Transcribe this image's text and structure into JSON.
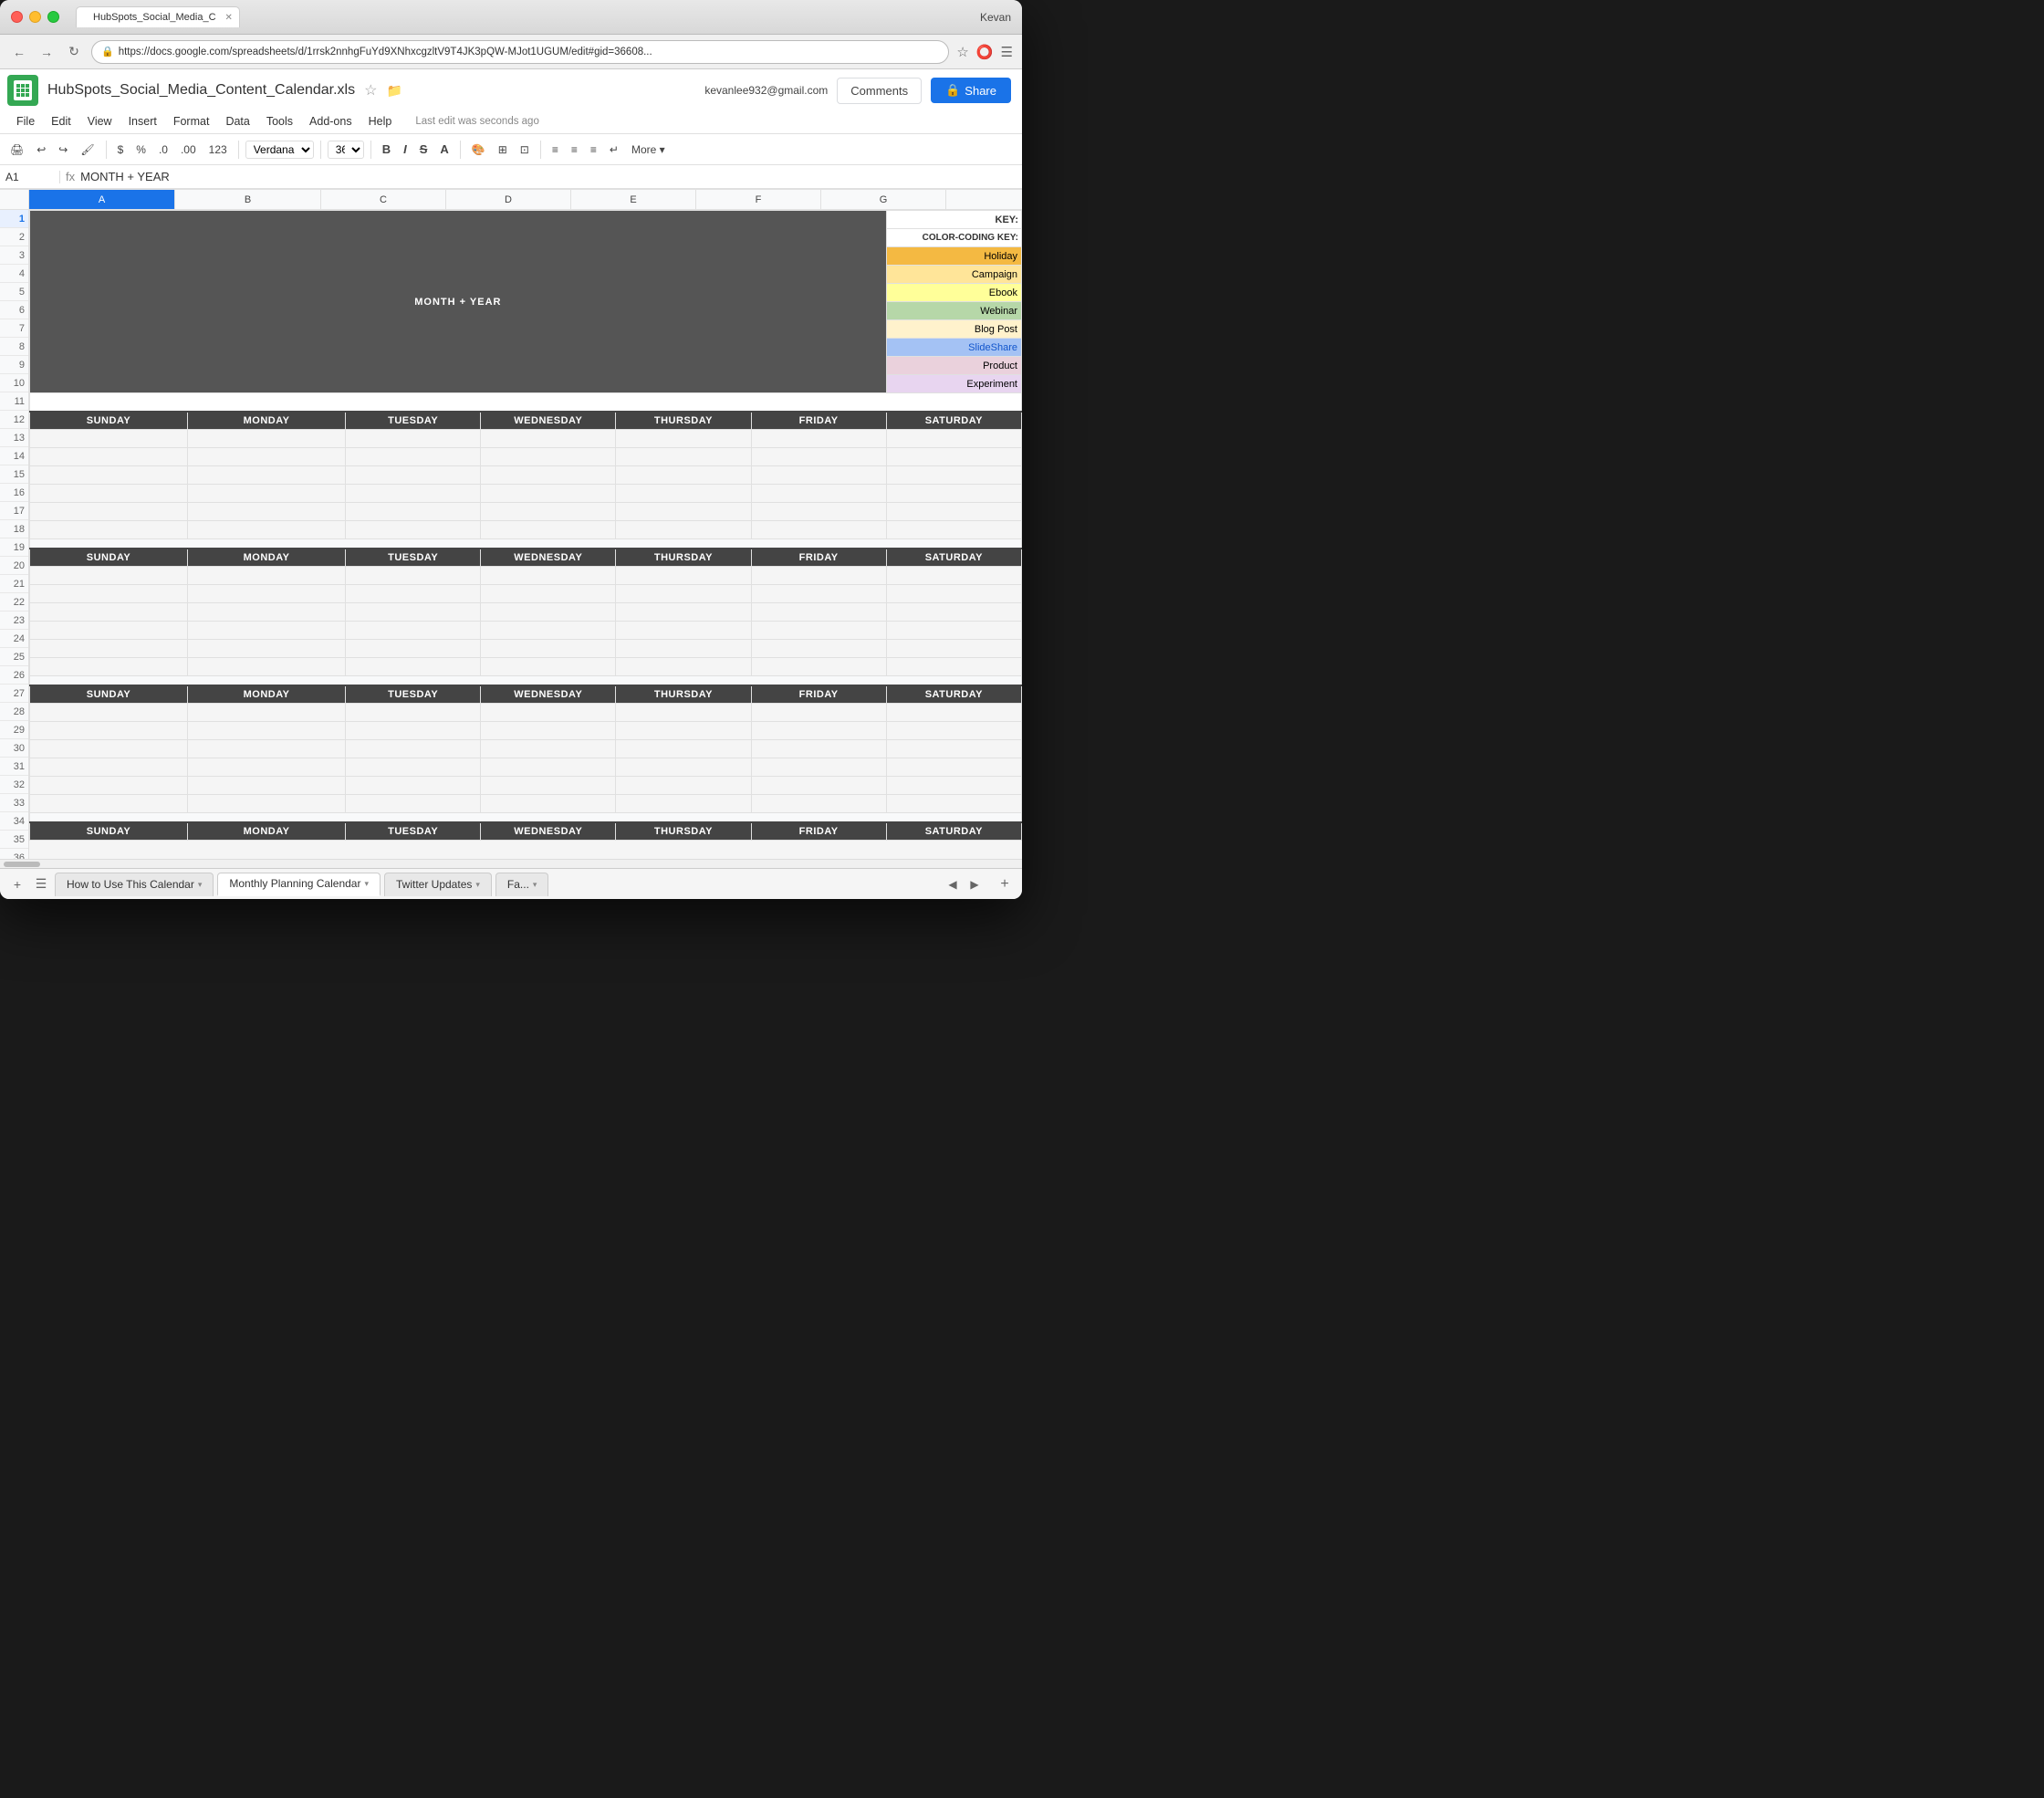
{
  "window": {
    "title": "HubSpots_Social_Media_C",
    "user": "Kevan",
    "url": "https://docs.google.com/spreadsheets/d/1rrsk2nnhgFuYd9XNhxcgzltV9T4JK3pQW-MJot1UGUM/edit#gid=36608...",
    "last_edit": "Last edit was seconds ago"
  },
  "doc": {
    "title": "HubSpots_Social_Media_Content_Calendar.xls",
    "user_email": "kevanlee932@gmail.com",
    "comments_label": "Comments",
    "share_label": "Share"
  },
  "menu": {
    "items": [
      "File",
      "Edit",
      "View",
      "Insert",
      "Format",
      "Data",
      "Tools",
      "Add-ons",
      "Help"
    ]
  },
  "toolbar": {
    "font": "Verdana",
    "font_size": "36",
    "more_label": "More",
    "format_buttons": [
      "B",
      "I",
      "S",
      "A"
    ]
  },
  "formula_bar": {
    "cell_ref": "A1",
    "content": "MONTH + YEAR"
  },
  "spreadsheet": {
    "columns": [
      "A",
      "B",
      "C",
      "D",
      "E",
      "F",
      "G"
    ],
    "title_text": "MONTH + YEAR",
    "key": {
      "title": "KEY:",
      "subtitle": "COLOR-CODING KEY:",
      "items": [
        {
          "label": "Holiday",
          "class": "key-holiday"
        },
        {
          "label": "Campaign",
          "class": "key-campaign"
        },
        {
          "label": "Ebook",
          "class": "key-ebook"
        },
        {
          "label": "Webinar",
          "class": "key-webinar"
        },
        {
          "label": "Blog Post",
          "class": "key-blogpost"
        },
        {
          "label": "SlideShare",
          "class": "key-slideshare"
        },
        {
          "label": "Product",
          "class": "key-product"
        },
        {
          "label": "Experiment",
          "class": "key-experiment"
        }
      ]
    },
    "day_headers": [
      "SUNDAY",
      "MONDAY",
      "TUESDAY",
      "WEDNESDAY",
      "THURSDAY",
      "FRIDAY",
      "SATURDAY"
    ]
  },
  "sheet_tabs": [
    {
      "label": "How to Use This Calendar",
      "active": false
    },
    {
      "label": "Monthly Planning Calendar",
      "active": true
    },
    {
      "label": "Twitter Updates",
      "active": false
    },
    {
      "label": "Fa...",
      "active": false
    }
  ]
}
